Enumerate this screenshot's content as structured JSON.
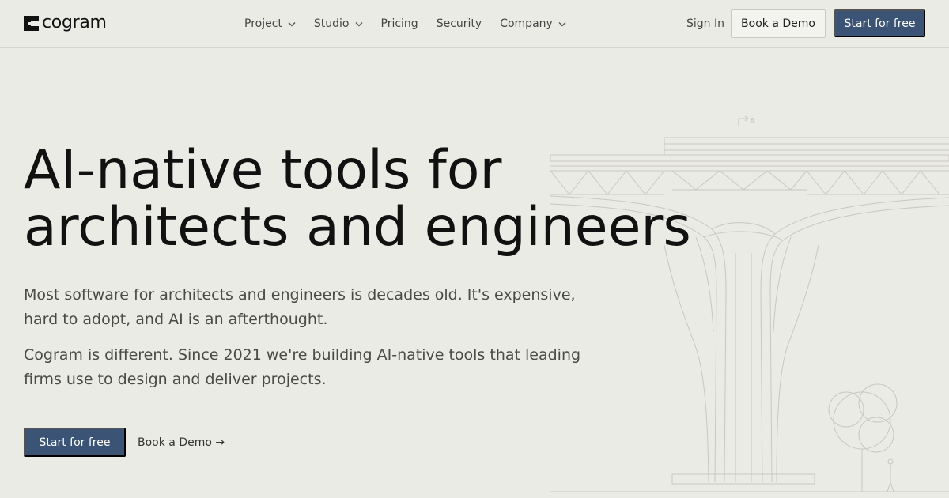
{
  "brand": {
    "name": "cogram"
  },
  "nav": {
    "items": [
      {
        "label": "Project",
        "dropdown": true
      },
      {
        "label": "Studio",
        "dropdown": true
      },
      {
        "label": "Pricing",
        "dropdown": false
      },
      {
        "label": "Security",
        "dropdown": false
      },
      {
        "label": "Company",
        "dropdown": true
      }
    ],
    "sign_in": "Sign In",
    "book_demo": "Book a Demo",
    "start_free": "Start for free"
  },
  "hero": {
    "title_line1": "AI-native tools for",
    "title_line2": "architects and engineers",
    "paragraph1": "Most software for architects and engineers is decades old. It's expensive, hard to adopt, and AI is an afterthought.",
    "paragraph2": "Cogram is different. Since 2021 we're building AI-native tools that leading firms use to design and deliver projects.",
    "cta_primary": "Start for free",
    "cta_secondary": "Book a Demo →"
  },
  "drawing": {
    "marker_label": "A"
  },
  "colors": {
    "background": "#ebebe6",
    "primary_button": "#3b5476",
    "text": "#111111",
    "muted_text": "#4a4a46"
  }
}
